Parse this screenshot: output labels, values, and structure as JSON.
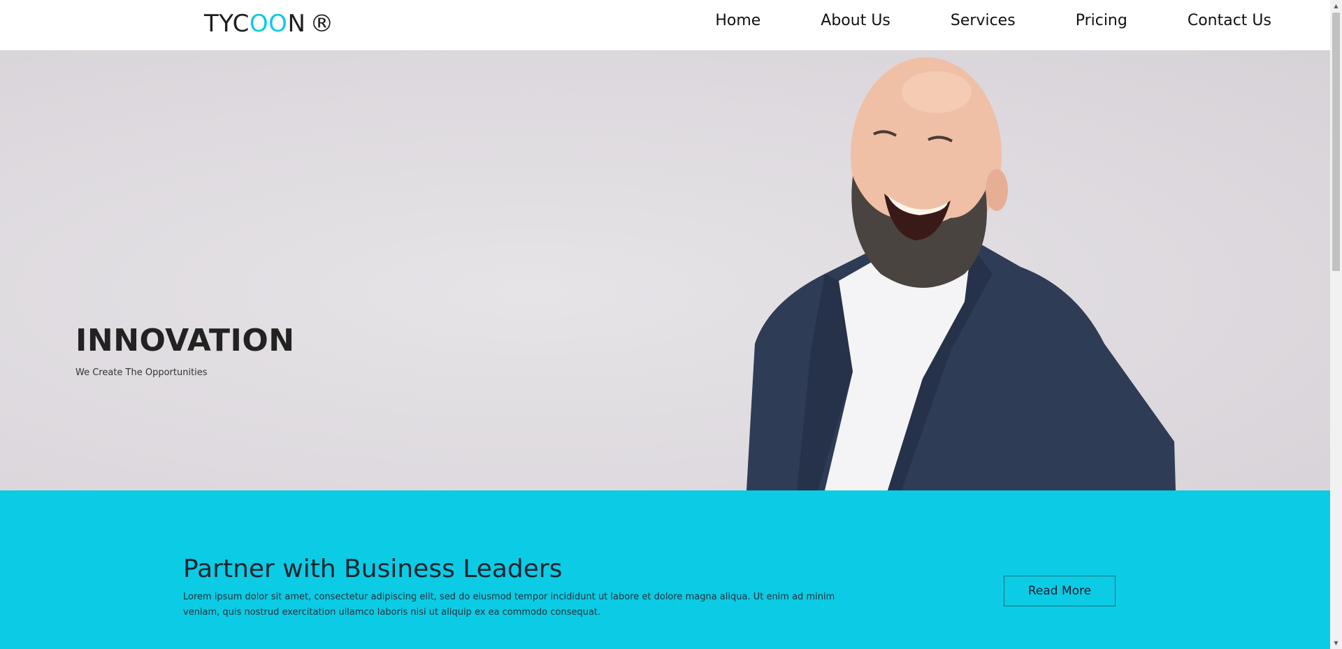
{
  "header": {
    "logo": {
      "part1": "TYC",
      "part2": "OO",
      "part3": "N",
      "reg_mark": "®"
    },
    "nav": [
      {
        "label": "Home"
      },
      {
        "label": "About Us"
      },
      {
        "label": "Services"
      },
      {
        "label": "Pricing"
      },
      {
        "label": "Contact Us"
      }
    ]
  },
  "hero": {
    "title": "INNOVATION",
    "subtitle": "We Create The Opportunities",
    "image": "smiling-bald-bearded-man-in-navy-blazer"
  },
  "cta": {
    "title": "Partner with Business Leaders",
    "text": "Lorem ipsum dolor sit amet, consectetur adipiscing elit, sed do eiusmod tempor incididunt ut labore et dolore magna aliqua. Ut enim ad minim veniam, quis nostrud exercitation ullamco laboris nisi ut aliquip ex ea commodo consequat.",
    "button_label": "Read More"
  },
  "colors": {
    "accent": "#0ccbe4",
    "text_dark": "#1e1e1e",
    "hero_bg": "#dedadf"
  },
  "icons": {
    "scroll_up": "arrow-up-icon",
    "scroll_down": "arrow-down-icon"
  }
}
